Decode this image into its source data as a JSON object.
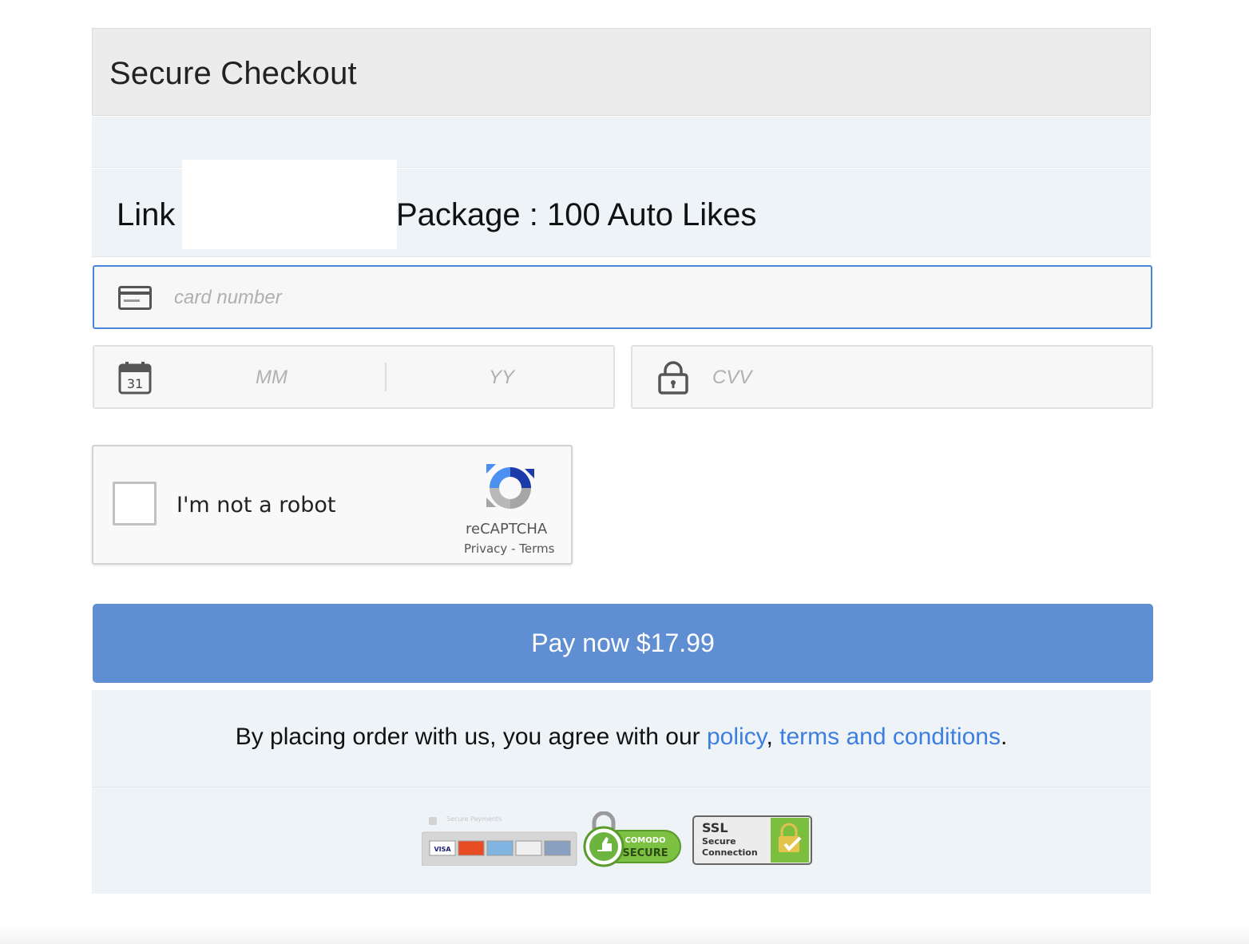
{
  "header": {
    "title": "Secure Checkout"
  },
  "order": {
    "link_label": "Link",
    "package_label": "Package : 100 Auto Likes"
  },
  "card": {
    "number_placeholder": "card number",
    "month_placeholder": "MM",
    "year_placeholder": "YY",
    "cvv_placeholder": "CVV",
    "calendar_day": "31"
  },
  "captcha": {
    "label": "I'm not a robot",
    "brand": "reCAPTCHA",
    "privacy": "Privacy",
    "dash": "-",
    "terms": "Terms"
  },
  "pay": {
    "label": "Pay now $17.99"
  },
  "agreement": {
    "prefix": "By placing order with us, you agree with our ",
    "policy_link": "policy",
    "comma": ", ",
    "terms_link": "terms and conditions",
    "suffix": "."
  },
  "badges": {
    "secure_payments": "Secure Payments",
    "cards": [
      "VISA",
      "MC",
      "AMEX",
      "DISCOVER",
      "BANK"
    ],
    "comodo_top": "COMODO",
    "comodo_bottom": "SECURE",
    "ssl_line1": "SSL",
    "ssl_line2": "Secure",
    "ssl_line3": "Connection"
  },
  "colors": {
    "accent": "#5f8ed2",
    "link": "#3d7fe0",
    "band": "#eef3f8",
    "header": "#ececec"
  }
}
